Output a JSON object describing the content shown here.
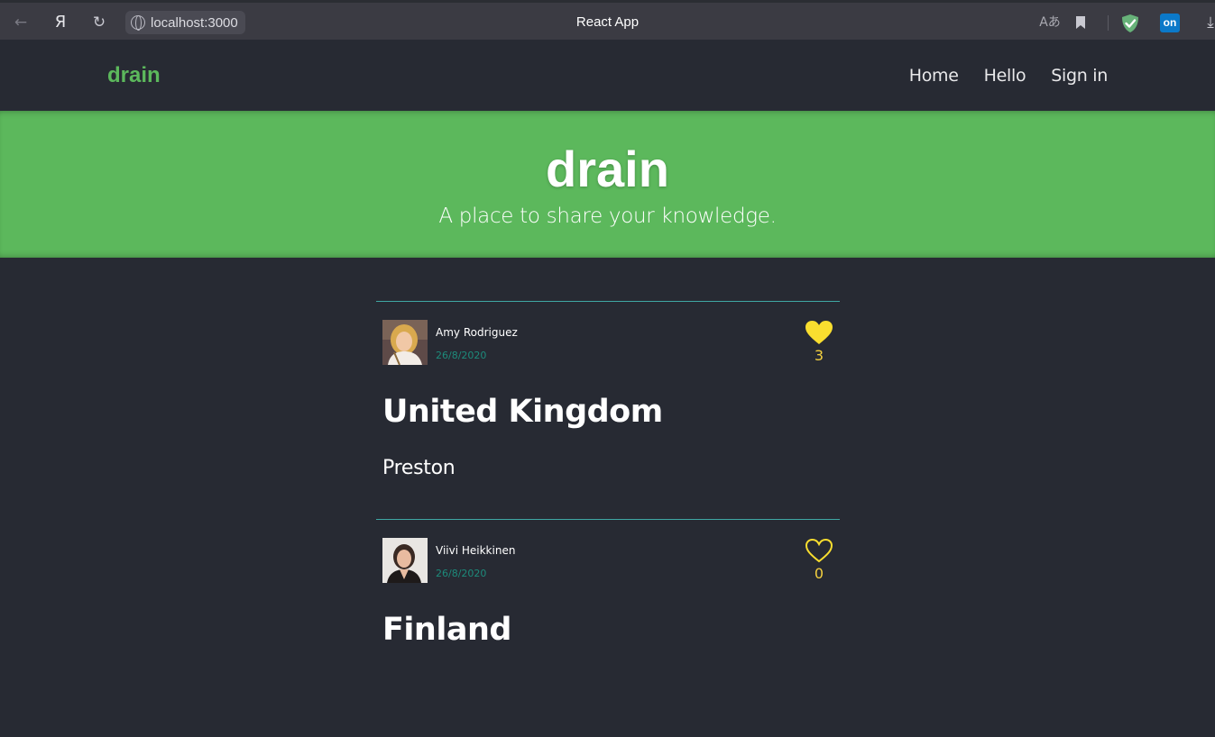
{
  "browser": {
    "url": "localhost:3000",
    "tab_title": "React App",
    "ya_glyph": "Я",
    "back_glyph": "←",
    "reload_glyph": "↻",
    "bookmark_glyph": "🔖",
    "download_glyph": "⤓",
    "translate_glyph": "Aあ",
    "ext_on_label": "on"
  },
  "navbar": {
    "brand": "drain",
    "links": [
      {
        "label": "Home"
      },
      {
        "label": "Hello"
      },
      {
        "label": "Sign in"
      }
    ]
  },
  "banner": {
    "title": "drain",
    "subtitle": "A place to share your knowledge."
  },
  "articles": [
    {
      "author": "Amy Rodriguez",
      "date": "26/8/2020",
      "likes": "3",
      "liked": true,
      "title": "United Kingdom",
      "body": "Preston"
    },
    {
      "author": "Viivi Heikkinen",
      "date": "26/8/2020",
      "likes": "0",
      "liked": false,
      "title": "Finland",
      "body": ""
    }
  ],
  "colors": {
    "brand_green": "#5cb85c",
    "background": "#272a33",
    "divider": "#3fa7a4",
    "like_yellow": "#f4d03f",
    "date_teal": "#1d8b7b"
  }
}
